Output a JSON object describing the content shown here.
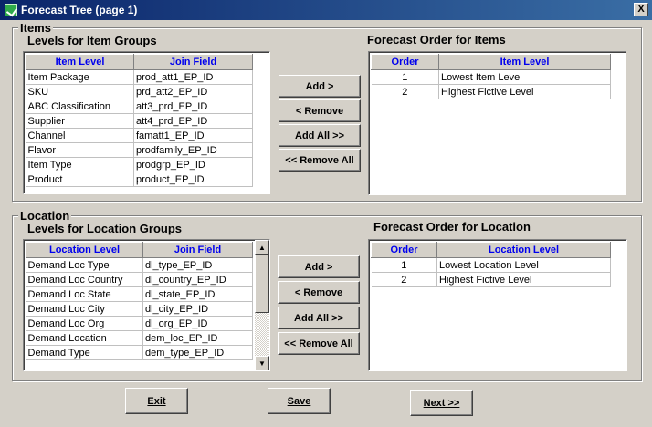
{
  "window": {
    "title": "Forecast Tree (page 1)",
    "close_label": "X"
  },
  "items": {
    "group_label": "Items",
    "levels_title": "Levels for Item Groups",
    "order_title": "Forecast Order for Items",
    "levels_headers": [
      "Item Level",
      "Join Field"
    ],
    "levels_rows": [
      [
        "Item Package",
        "prod_att1_EP_ID"
      ],
      [
        "SKU",
        "prd_att2_EP_ID"
      ],
      [
        "ABC Classification",
        "att3_prd_EP_ID"
      ],
      [
        "Supplier",
        "att4_prd_EP_ID"
      ],
      [
        "Channel",
        "famatt1_EP_ID"
      ],
      [
        "Flavor",
        "prodfamily_EP_ID"
      ],
      [
        "Item Type",
        "prodgrp_EP_ID"
      ],
      [
        "Product",
        "product_EP_ID"
      ]
    ],
    "order_headers": [
      "Order",
      "Item Level"
    ],
    "order_rows": [
      [
        "1",
        "Lowest Item Level"
      ],
      [
        "2",
        "Highest Fictive Level"
      ]
    ],
    "buttons": {
      "add": "Add >",
      "remove": "< Remove",
      "add_all": "Add All >>",
      "remove_all": "<< Remove All"
    }
  },
  "location": {
    "group_label": "Location",
    "levels_title": "Levels for Location Groups",
    "order_title": "Forecast Order for Location",
    "levels_headers": [
      "Location Level",
      "Join Field"
    ],
    "levels_rows": [
      [
        "Demand Loc Type",
        "dl_type_EP_ID"
      ],
      [
        "Demand Loc Country",
        "dl_country_EP_ID"
      ],
      [
        "Demand Loc State",
        "dl_state_EP_ID"
      ],
      [
        "Demand Loc City",
        "dl_city_EP_ID"
      ],
      [
        "Demand Loc Org",
        "dl_org_EP_ID"
      ],
      [
        "Demand Location",
        "dem_loc_EP_ID"
      ],
      [
        "Demand Type",
        "dem_type_EP_ID"
      ]
    ],
    "order_headers": [
      "Order",
      "Location Level"
    ],
    "order_rows": [
      [
        "1",
        "Lowest Location Level"
      ],
      [
        "2",
        "Highest Fictive Level"
      ]
    ],
    "buttons": {
      "add": "Add >",
      "remove": "< Remove",
      "add_all": "Add All >>",
      "remove_all": "<< Remove All"
    }
  },
  "footer": {
    "exit": "Exit",
    "save": "Save",
    "next": "Next >>"
  }
}
